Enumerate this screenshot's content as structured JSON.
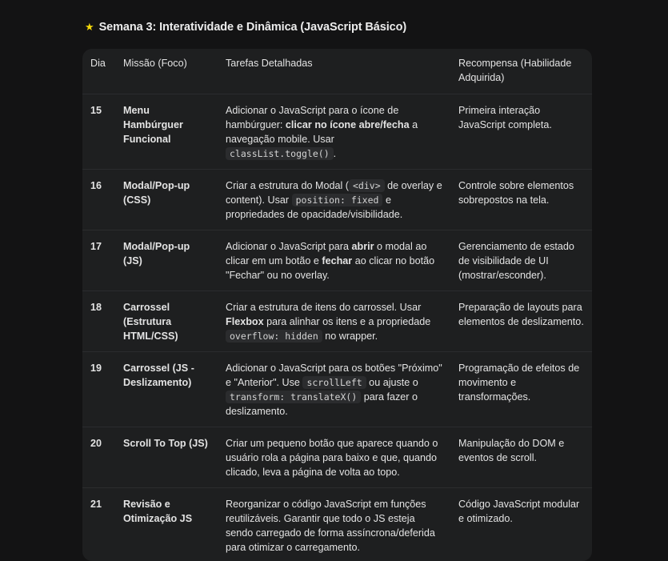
{
  "heading": {
    "icon": "star-icon",
    "text": "Semana 3: Interatividade e Dinâmica (JavaScript Básico)"
  },
  "table": {
    "headers": [
      "Dia",
      "Missão (Foco)",
      "Tarefas Detalhadas",
      "Recompensa (Habilidade Adquirida)"
    ],
    "rows": [
      {
        "day": "15",
        "mission": "Menu Hambúrguer Funcional",
        "tasks": [
          {
            "t": "text",
            "v": "Adicionar o JavaScript para o ícone de hambúrguer: "
          },
          {
            "t": "bold",
            "v": "clicar no ícone abre/fecha"
          },
          {
            "t": "text",
            "v": " a navegação mobile. Usar "
          },
          {
            "t": "code",
            "v": "classList.toggle()"
          },
          {
            "t": "text",
            "v": "."
          }
        ],
        "reward": "Primeira interação JavaScript completa."
      },
      {
        "day": "16",
        "mission": "Modal/Pop-up (CSS)",
        "tasks": [
          {
            "t": "text",
            "v": "Criar a estrutura do Modal ("
          },
          {
            "t": "code",
            "v": "<div>"
          },
          {
            "t": "text",
            "v": " de overlay e content). Usar "
          },
          {
            "t": "code",
            "v": "position: fixed"
          },
          {
            "t": "text",
            "v": " e propriedades de opacidade/visibilidade."
          }
        ],
        "reward": "Controle sobre elementos sobrepostos na tela."
      },
      {
        "day": "17",
        "mission": "Modal/Pop-up (JS)",
        "tasks": [
          {
            "t": "text",
            "v": "Adicionar o JavaScript para "
          },
          {
            "t": "bold",
            "v": "abrir"
          },
          {
            "t": "text",
            "v": " o modal ao clicar em um botão e "
          },
          {
            "t": "bold",
            "v": "fechar"
          },
          {
            "t": "text",
            "v": " ao clicar no botão \"Fechar\" ou no overlay."
          }
        ],
        "reward": "Gerenciamento de estado de visibilidade de UI (mostrar/esconder)."
      },
      {
        "day": "18",
        "mission": "Carrossel (Estrutura HTML/CSS)",
        "tasks": [
          {
            "t": "text",
            "v": "Criar a estrutura de itens do carrossel. Usar "
          },
          {
            "t": "bold",
            "v": "Flexbox"
          },
          {
            "t": "text",
            "v": " para alinhar os itens e a propriedade "
          },
          {
            "t": "code",
            "v": "overflow: hidden"
          },
          {
            "t": "text",
            "v": " no wrapper."
          }
        ],
        "reward": "Preparação de layouts para elementos de deslizamento."
      },
      {
        "day": "19",
        "mission": "Carrossel (JS - Deslizamento)",
        "tasks": [
          {
            "t": "text",
            "v": "Adicionar o JavaScript para os botões \"Próximo\" e \"Anterior\". Use "
          },
          {
            "t": "code",
            "v": "scrollLeft"
          },
          {
            "t": "text",
            "v": " ou ajuste o "
          },
          {
            "t": "code",
            "v": "transform: translateX()"
          },
          {
            "t": "text",
            "v": " para fazer o deslizamento."
          }
        ],
        "reward": "Programação de efeitos de movimento e transformações."
      },
      {
        "day": "20",
        "mission": "Scroll To Top (JS)",
        "tasks": [
          {
            "t": "text",
            "v": "Criar um pequeno botão que aparece quando o usuário rola a página para baixo e que, quando clicado, leva a página de volta ao topo."
          }
        ],
        "reward": "Manipulação do DOM e eventos de scroll."
      },
      {
        "day": "21",
        "mission": "Revisão e Otimização JS",
        "tasks": [
          {
            "t": "text",
            "v": "Reorganizar o código JavaScript em funções reutilizáveis. Garantir que todo o JS esteja sendo carregado de forma assíncrona/deferida para otimizar o carregamento."
          }
        ],
        "reward": "Código JavaScript modular e otimizado."
      }
    ]
  }
}
